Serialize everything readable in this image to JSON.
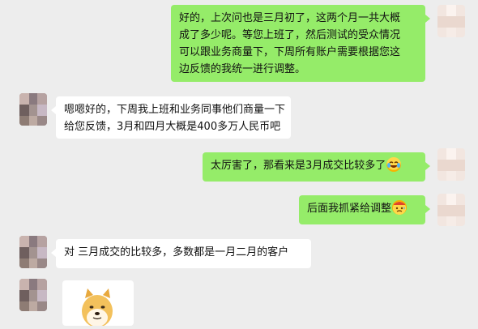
{
  "messages": [
    {
      "side": "out",
      "lines": [
        "好的，上次问也是三月初了，这两个月一共大概",
        "成了多少呢。等您上班了，然后测试的受众情况",
        "可以跟业务商量下，下周所有账户需要根据您这",
        "边反馈的我统一进行调整。"
      ]
    },
    {
      "side": "in",
      "lines": [
        "嗯嗯好的，下周我上班和业务同事他们商量一下",
        "给您反馈，3月和四月大概是400多万人民币吧"
      ]
    },
    {
      "side": "out",
      "text": "太厉害了，那看来是3月成交比较多了",
      "emoji": "laughing-tears-emoji"
    },
    {
      "side": "out",
      "text": "后面我抓紧给调整",
      "emoji": "sweating-hat-emoji"
    },
    {
      "side": "in",
      "text": "对 三月成交的比较多，多数都是一月二月的客户"
    },
    {
      "side": "in",
      "sticker": "doge-dog-sticker"
    }
  ],
  "colors": {
    "background": "#ededed",
    "outgoing_bubble": "#95ec69",
    "incoming_bubble": "#ffffff"
  }
}
